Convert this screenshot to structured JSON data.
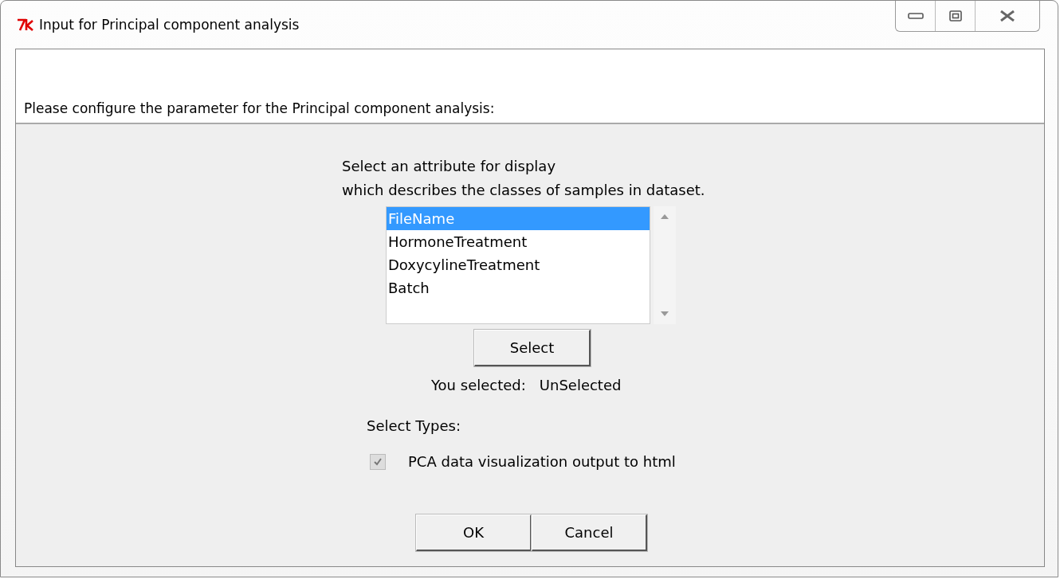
{
  "window": {
    "title": "Input for Principal component analysis"
  },
  "header": {
    "text": "Please configure the parameter for the Principal component analysis:"
  },
  "prompt": [
    "Select an attribute for display",
    "which describes the classes of samples in dataset."
  ],
  "attributes": [
    {
      "label": "FileName",
      "selected": true
    },
    {
      "label": "HormoneTreatment",
      "selected": false
    },
    {
      "label": "DoxycylineTreatment",
      "selected": false
    },
    {
      "label": "Batch",
      "selected": false
    }
  ],
  "select_button": "Select",
  "selection": {
    "label": "You selected:",
    "value": "UnSelected"
  },
  "types_label": "Select Types:",
  "options": [
    {
      "label": "PCA data visualization output to html",
      "checked": true,
      "disabled": true
    }
  ],
  "buttons": [
    "OK",
    "Cancel"
  ]
}
